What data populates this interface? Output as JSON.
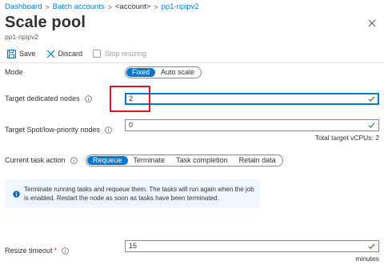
{
  "breadcrumb": {
    "items": [
      "Dashboard",
      "Batch accounts",
      "<account>",
      "pp1-npipv2"
    ],
    "separator": ">"
  },
  "page": {
    "title": "Scale pool",
    "subtitle": "pp1-npipv2"
  },
  "toolbar": {
    "save_label": "Save",
    "discard_label": "Discard",
    "stop_resizing_label": "Stop resizing"
  },
  "form": {
    "mode": {
      "label": "Mode",
      "options": [
        "Fixed",
        "Auto scale"
      ],
      "selected": "Fixed"
    },
    "target_dedicated": {
      "label": "Target dedicated nodes",
      "value": "2"
    },
    "target_spot": {
      "label": "Target Spot/low-priority nodes",
      "value": "0",
      "hint": "Total target vCPUs: 2"
    },
    "task_action": {
      "label": "Current task action",
      "options": [
        "Requeue",
        "Terminate",
        "Task completion",
        "Retain data"
      ],
      "selected": "Requeue"
    },
    "info": {
      "text": "Terminate running tasks and requeue them. The tasks will run again when the job is enabled. Restart the node as soon as tasks have been terminated."
    },
    "resize_timeout": {
      "label": "Resize timeout",
      "required_mark": "*",
      "value": "15",
      "unit": "minutes"
    }
  },
  "colors": {
    "accent": "#0078d4",
    "success": "#107c10",
    "highlight": "#e81123",
    "info_bg": "#f0f6ff"
  },
  "icons": {
    "save": "save-icon",
    "discard": "close-icon",
    "info": "info-icon",
    "valid": "checkmark-icon"
  }
}
